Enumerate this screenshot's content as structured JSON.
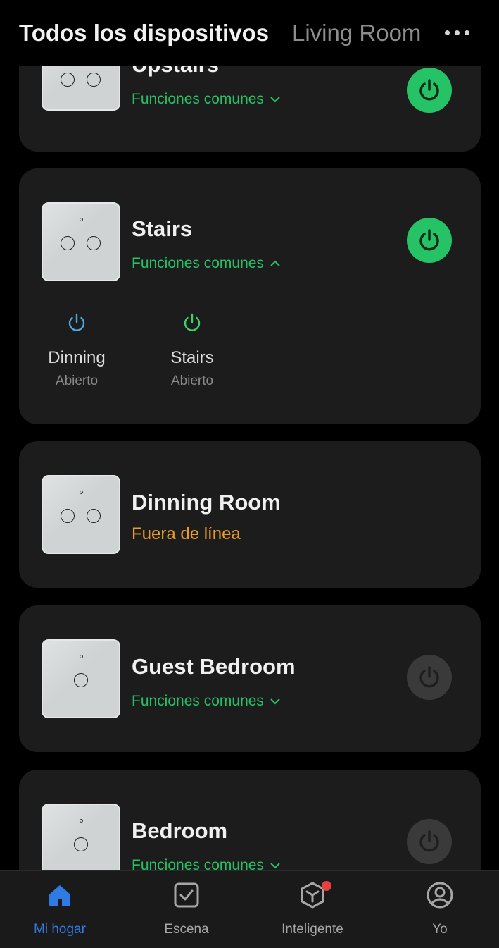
{
  "header": {
    "tab_active": "Todos los dispositivos",
    "tab_inactive": "Living Room",
    "more_icon": "more-horizontal-icon"
  },
  "devices": [
    {
      "name": "Upstairs",
      "subtitle": "Funciones comunes",
      "power": "on",
      "buttons": 2,
      "expanded": false
    },
    {
      "name": "Stairs",
      "subtitle": "Funciones comunes",
      "power": "on",
      "buttons": 2,
      "expanded": true,
      "sub_switches": [
        {
          "name": "Dinning",
          "status": "Abierto",
          "color": "#4aa8e0"
        },
        {
          "name": "Stairs",
          "status": "Abierto",
          "color": "#3fcf6a"
        }
      ]
    },
    {
      "name": "Dinning Room",
      "subtitle": "Fuera de línea",
      "power": "none",
      "buttons": 2
    },
    {
      "name": "Guest Bedroom",
      "subtitle": "Funciones comunes",
      "power": "off",
      "buttons": 1,
      "expanded": false
    },
    {
      "name": "Bedroom",
      "subtitle": "Funciones comunes",
      "power": "off",
      "buttons": 1,
      "expanded": false
    }
  ],
  "nav": [
    {
      "label": "Mi hogar",
      "icon": "home-icon",
      "active": true
    },
    {
      "label": "Escena",
      "icon": "scene-check-icon",
      "active": false
    },
    {
      "label": "Inteligente",
      "icon": "smart-cube-icon",
      "active": false,
      "badge": true
    },
    {
      "label": "Yo",
      "icon": "profile-icon",
      "active": false
    }
  ],
  "colors": {
    "accent_green": "#26c366",
    "offline_orange": "#e89a2a",
    "nav_active_blue": "#2f7ae5",
    "badge_red": "#e8403a"
  }
}
